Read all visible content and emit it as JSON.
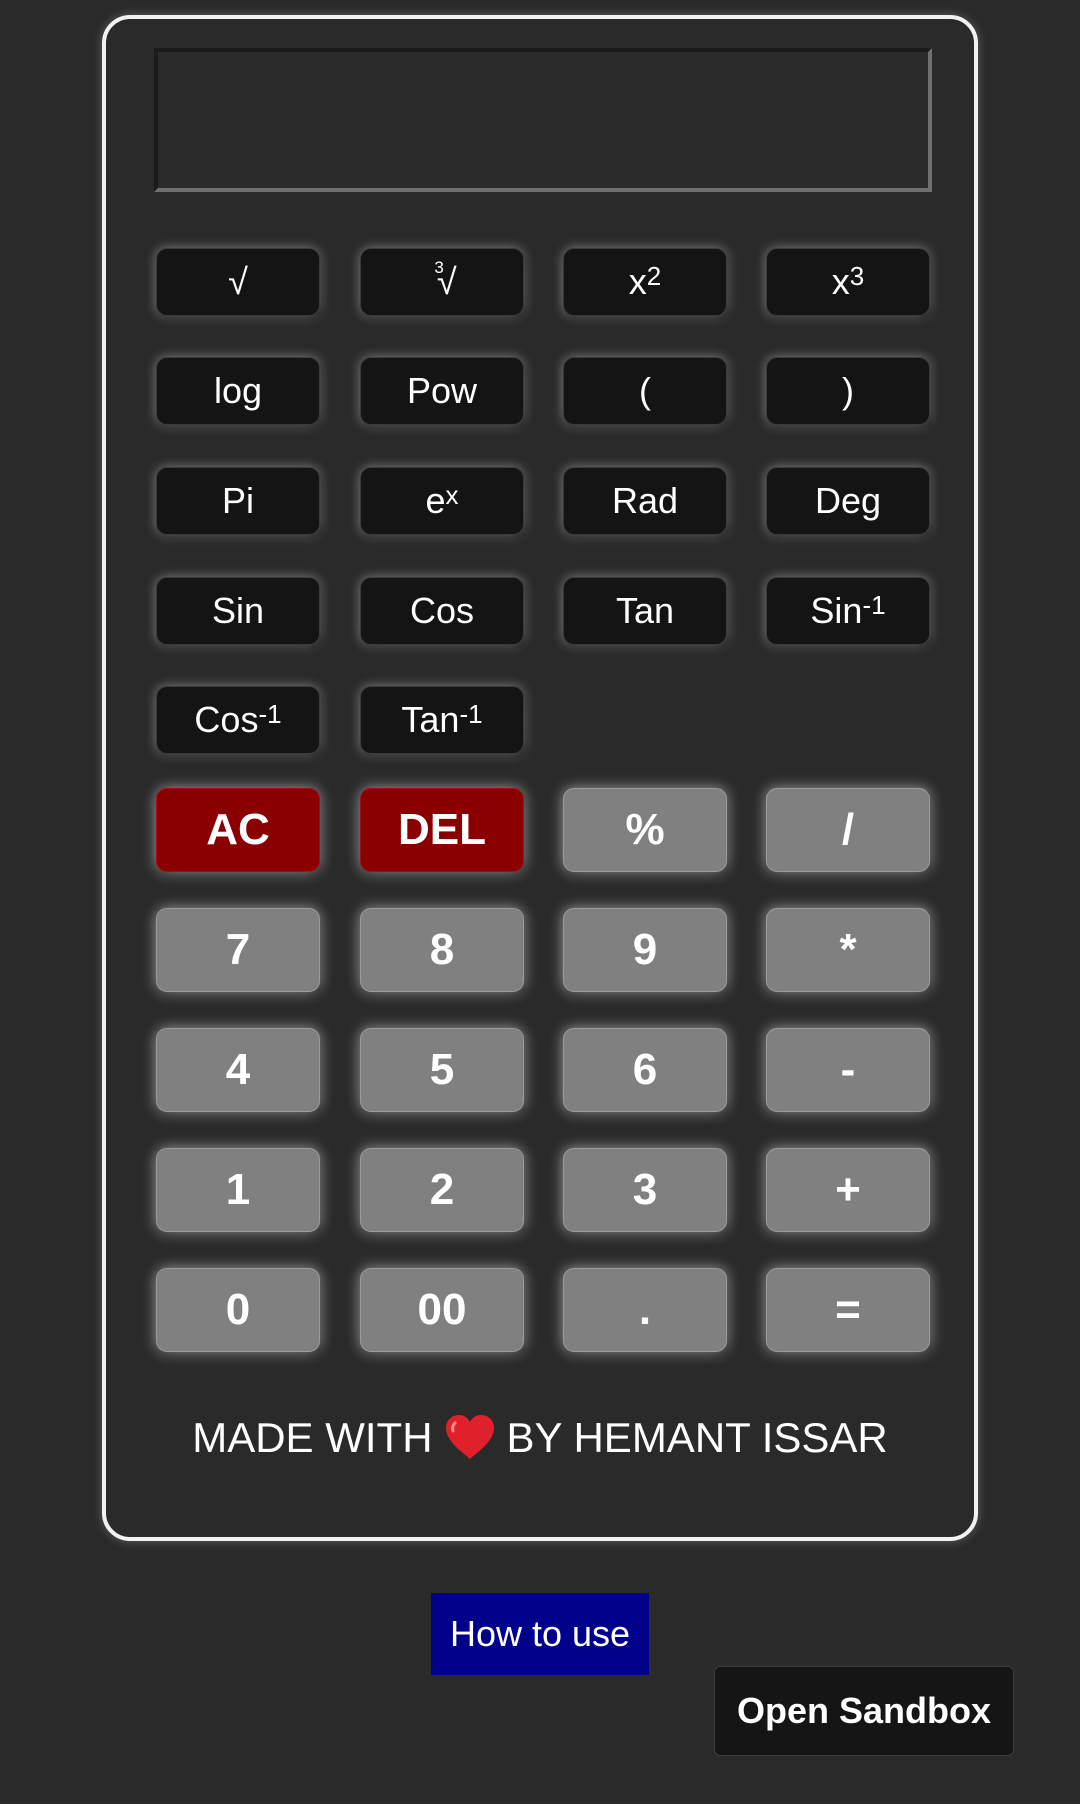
{
  "display": {
    "value": ""
  },
  "scientific": {
    "sqrt": "√",
    "cbrt_index": "3",
    "cbrt_radical": "√",
    "square_base": "x",
    "square_exp": "2",
    "cube_base": "x",
    "cube_exp": "3",
    "log": "log",
    "pow": "Pow",
    "open_paren": "(",
    "close_paren": ")",
    "pi": "Pi",
    "exp_base": "e",
    "exp_exp": "x",
    "rad": "Rad",
    "deg": "Deg",
    "sin": "Sin",
    "cos": "Cos",
    "tan": "Tan",
    "asin_base": "Sin",
    "asin_exp": "-1",
    "acos_base": "Cos",
    "acos_exp": "-1",
    "atan_base": "Tan",
    "atan_exp": "-1"
  },
  "keypad": {
    "ac": "AC",
    "del": "DEL",
    "percent": "%",
    "divide": "/",
    "seven": "7",
    "eight": "8",
    "nine": "9",
    "multiply": "*",
    "four": "4",
    "five": "5",
    "six": "6",
    "minus": "-",
    "one": "1",
    "two": "2",
    "three": "3",
    "plus": "+",
    "zero": "0",
    "double_zero": "00",
    "decimal": ".",
    "equals": "="
  },
  "credit": {
    "prefix": "MADE WITH",
    "heart_icon": "heart-icon",
    "suffix": "BY HEMANT ISSAR"
  },
  "links": {
    "how_to_use": "How to use",
    "open_sandbox": "Open Sandbox"
  },
  "colors": {
    "background": "#2a2a2b",
    "function_button": "#141414",
    "number_button": "#808080",
    "danger_button": "#8a0000",
    "how_to_use_button": "#00008b",
    "heart": "#e0202a"
  }
}
